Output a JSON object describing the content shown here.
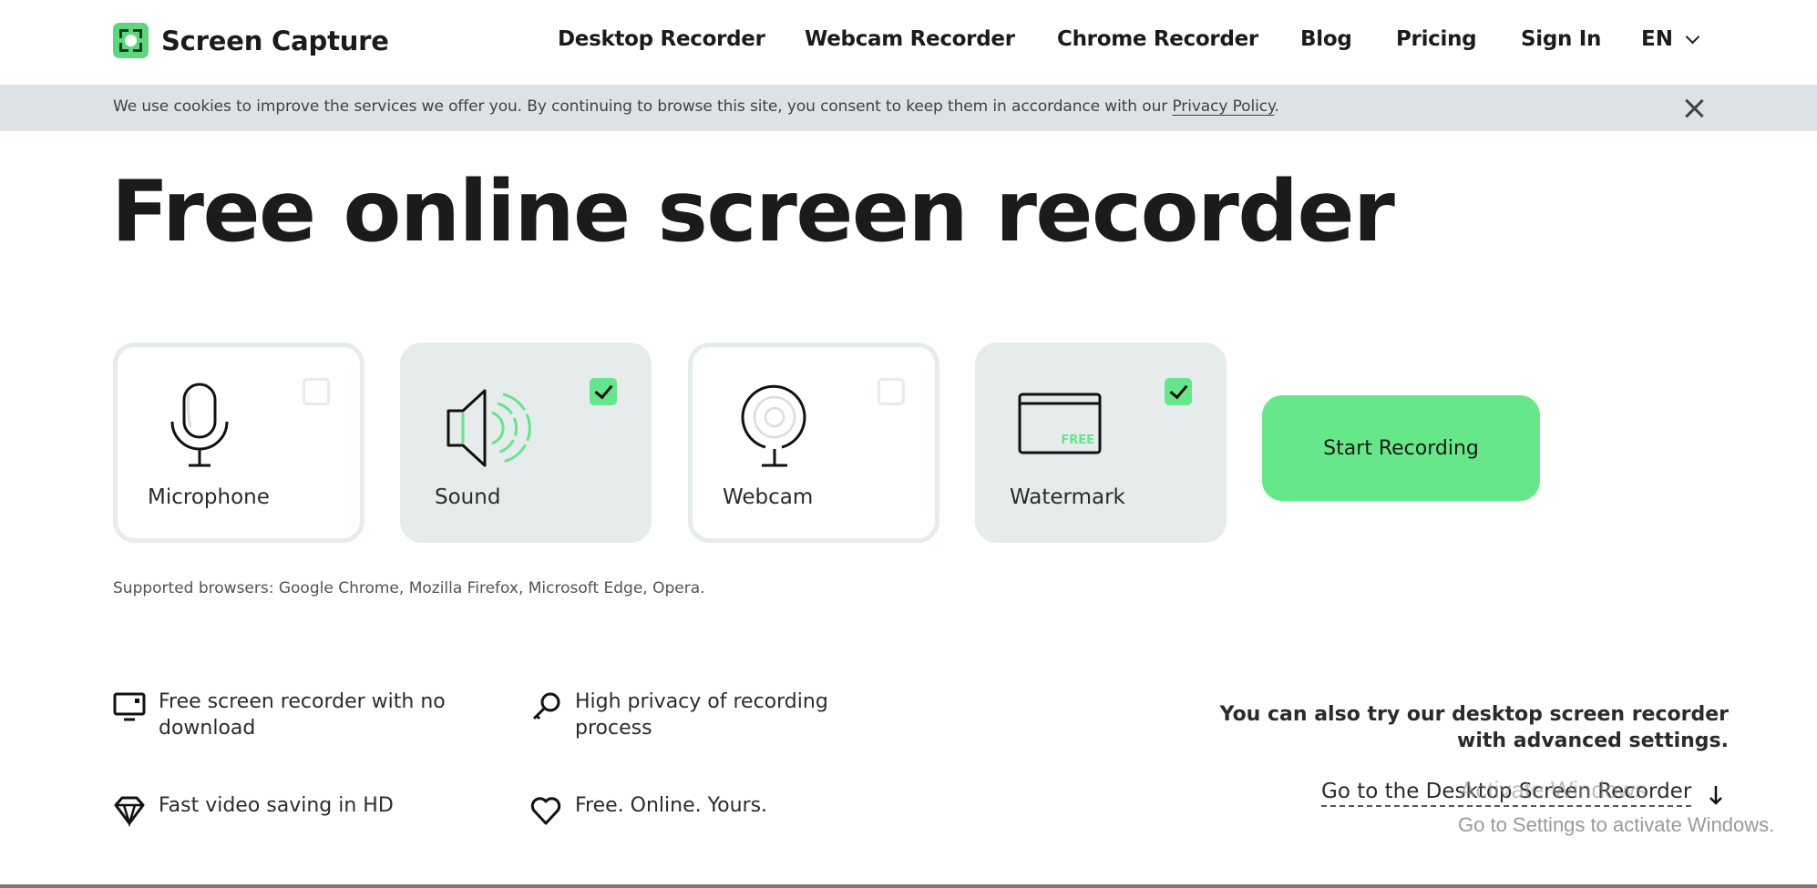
{
  "header": {
    "logo_text": "Screen Capture",
    "nav": [
      {
        "label": "Desktop Recorder"
      },
      {
        "label": "Webcam Recorder"
      },
      {
        "label": "Chrome Recorder"
      },
      {
        "label": "Blog"
      },
      {
        "label": "Pricing"
      },
      {
        "label": "Sign In"
      }
    ],
    "language": "EN"
  },
  "cookie_banner": {
    "text": "We use cookies to improve the services we offer you. By continuing to browse this site, you consent to keep them in accordance with our ",
    "link_text": "Privacy Policy",
    "suffix": "."
  },
  "main": {
    "title": "Free online screen recorder",
    "options": [
      {
        "label": "Microphone",
        "icon": "microphone-icon",
        "checked": false
      },
      {
        "label": "Sound",
        "icon": "speaker-icon",
        "checked": true
      },
      {
        "label": "Webcam",
        "icon": "webcam-icon",
        "checked": false
      },
      {
        "label": "Watermark",
        "icon": "watermark-icon",
        "checked": true,
        "badge": "FREE"
      }
    ],
    "start_button": "Start Recording",
    "supported_browsers": "Supported browsers: Google Chrome, Mozilla Firefox, Microsoft Edge, Opera."
  },
  "features": [
    {
      "text": "Free screen recorder with no download",
      "icon": "monitor-icon"
    },
    {
      "text": "High privacy of recording process",
      "icon": "key-icon"
    },
    {
      "text": "Fast video saving in HD",
      "icon": "diamond-icon"
    },
    {
      "text": "Free. Online. Yours.",
      "icon": "heart-icon"
    }
  ],
  "promo": {
    "line1": "You can also try our desktop screen recorder",
    "line2": "with advanced settings.",
    "link": "Go to the Desktop Screen Recorder"
  },
  "windows_watermark": {
    "line1": "Activate Windows",
    "line2": "Go to Settings to activate Windows."
  },
  "colors": {
    "accent_green": "#66e88a",
    "cookie_bg": "#dce2e6",
    "card_bg": "#e6ebec",
    "text": "#1b1b1b"
  }
}
